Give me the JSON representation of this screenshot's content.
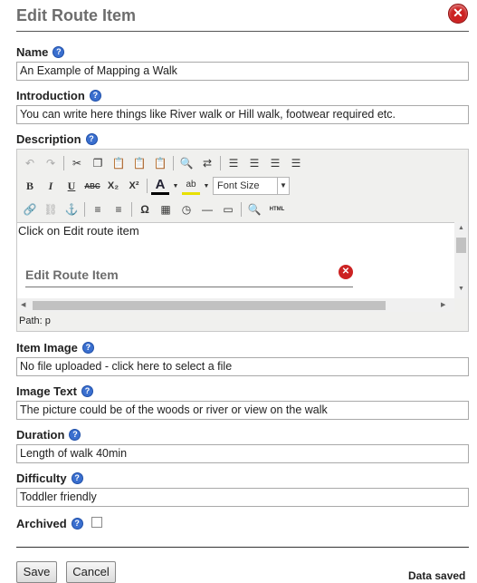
{
  "dialog": {
    "title": "Edit Route Item",
    "close_glyph": "✕"
  },
  "fields": {
    "name": {
      "label": "Name",
      "value": "An Example of Mapping a Walk"
    },
    "introduction": {
      "label": "Introduction",
      "value": "You can write here things like River walk or Hill walk, footwear required etc."
    },
    "description": {
      "label": "Description"
    },
    "item_image": {
      "label": "Item Image",
      "value": "No file uploaded - click here to select a file"
    },
    "image_text": {
      "label": "Image Text",
      "value": "The picture could be of the woods or river or view on the walk"
    },
    "duration": {
      "label": "Duration",
      "value": "Length of walk 40min"
    },
    "difficulty": {
      "label": "Difficulty",
      "value": "Toddler friendly"
    },
    "archived": {
      "label": "Archived",
      "checked": false
    }
  },
  "help_glyph": "?",
  "editor": {
    "font_size_label": "Font Size",
    "content_text": "Click on Edit route item",
    "embedded_title": "Edit Route Item",
    "path_label": "Path: p",
    "toolbar_row1": [
      "undo-icon",
      "redo-icon",
      "cut-icon",
      "copy-icon",
      "paste-icon",
      "paste-text-icon",
      "paste-word-icon",
      "find-icon",
      "replace-icon",
      "align-left-icon",
      "align-center-icon",
      "align-right-icon",
      "align-justify-icon"
    ],
    "toolbar_row2": [
      "bold-icon",
      "italic-icon",
      "underline-icon",
      "strikethrough-icon",
      "subscript-icon",
      "superscript-icon",
      "text-color-icon",
      "highlight-color-icon"
    ],
    "toolbar_row3": [
      "link-icon",
      "unlink-icon",
      "anchor-icon",
      "bullet-list-icon",
      "numbered-list-icon",
      "special-char-icon",
      "date-icon",
      "time-icon",
      "horizontal-rule-icon",
      "template-icon",
      "preview-icon",
      "html-source-icon"
    ],
    "glyphs": {
      "bold": "B",
      "italic": "I",
      "underline": "U",
      "strike": "ABC",
      "sub": "X₂",
      "sup": "X²",
      "text_color": "A",
      "highlight": "ab",
      "omega": "Ω",
      "html": "HTML"
    }
  },
  "buttons": {
    "save": "Save",
    "cancel": "Cancel"
  },
  "status": {
    "data_saved": "Data saved"
  },
  "colors": {
    "title": "#6d6d6d",
    "close": "#cc2222",
    "help": "#3a6fcf"
  }
}
